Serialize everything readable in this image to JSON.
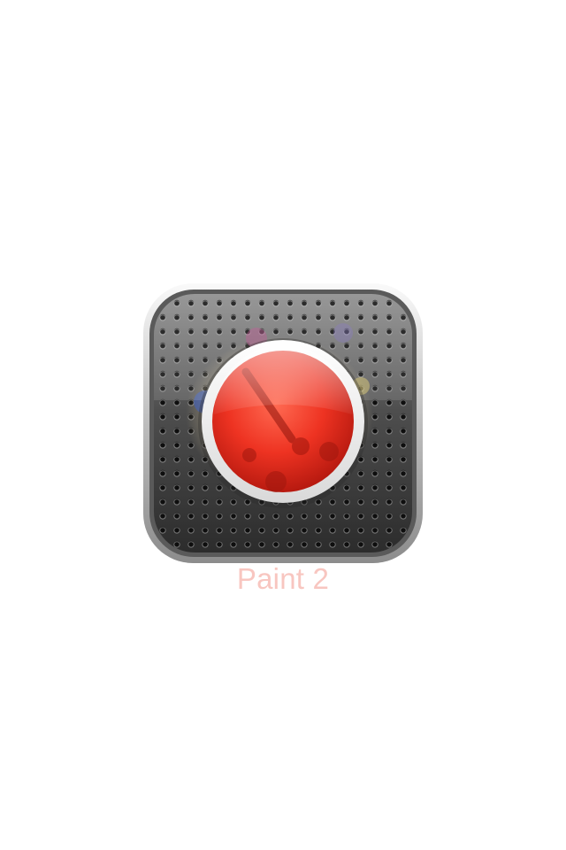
{
  "app": {
    "label": "Paint 2",
    "icon": "record-button-icon",
    "overlay_icon": "paint-palette-icon"
  },
  "colors": {
    "background": "#ffffff",
    "button_red": "#e8291c",
    "label_color": "#f8c6c0"
  }
}
